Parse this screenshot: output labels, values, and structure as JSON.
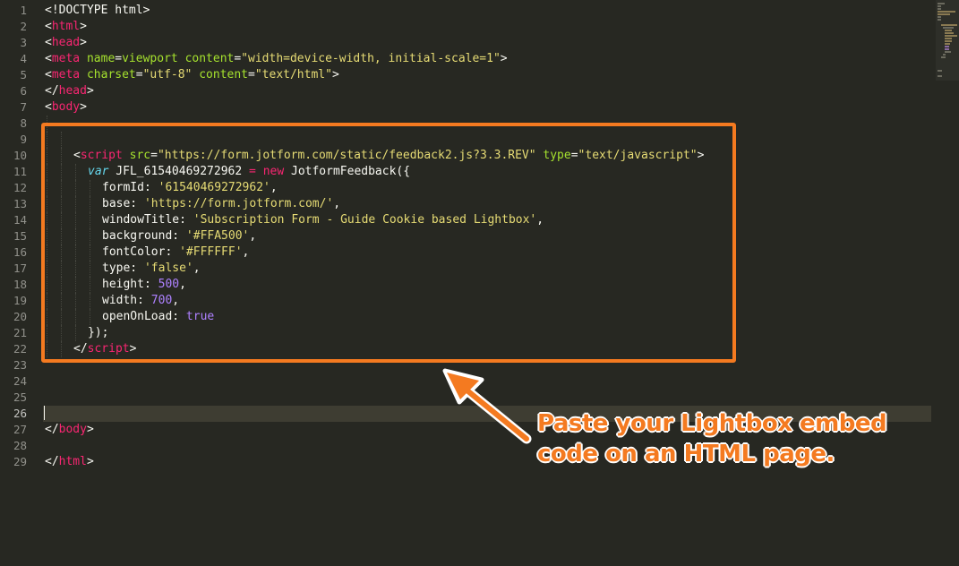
{
  "editor": {
    "theme_colors": {
      "background": "#272822",
      "tag": "#f92672",
      "attribute": "#a6e22e",
      "string": "#e6db74",
      "number": "#ae81ff",
      "keyword_italic": "#66d9ef",
      "highlight_box": "#f47a20"
    },
    "active_line": 26,
    "line_numbers": [
      "1",
      "2",
      "3",
      "4",
      "5",
      "6",
      "7",
      "8",
      "9",
      "10",
      "11",
      "12",
      "13",
      "14",
      "15",
      "16",
      "17",
      "18",
      "19",
      "20",
      "21",
      "22",
      "23",
      "24",
      "25",
      "26",
      "27",
      "28",
      "29"
    ],
    "lines": {
      "l1": {
        "a": "<!DOCTYPE html>"
      },
      "l2": {
        "a": "<",
        "b": "html",
        "c": ">"
      },
      "l3": {
        "a": "<",
        "b": "head",
        "c": ">"
      },
      "l4": {
        "a": "<",
        "b": "meta",
        "c": " ",
        "d": "name",
        "e": "=",
        "f": "viewport",
        "g": " ",
        "h": "content",
        "i": "=",
        "j": "\"width=device-width, initial-scale=1\"",
        "k": ">"
      },
      "l5": {
        "a": "<",
        "b": "meta",
        "c": " ",
        "d": "charset",
        "e": "=",
        "f": "\"utf-8\"",
        "g": " ",
        "h": "content",
        "i": "=",
        "j": "\"text/html\"",
        "k": ">"
      },
      "l6": {
        "a": "</",
        "b": "head",
        "c": ">"
      },
      "l7": {
        "a": "<",
        "b": "body",
        "c": ">"
      },
      "l10": {
        "a": "<",
        "b": "script",
        "c": " ",
        "d": "src",
        "e": "=",
        "f": "\"https://form.jotform.com/static/feedback2.js?3.3.REV\"",
        "g": " ",
        "h": "type",
        "i": "=",
        "j": "\"text/javascript\"",
        "k": ">"
      },
      "l11": {
        "a": "var",
        "b": " JFL_61540469272962 ",
        "c": "=",
        "d": " ",
        "e": "new",
        "f": " JotformFeedback({"
      },
      "l12": {
        "a": "formId: ",
        "b": "'61540469272962'",
        "c": ","
      },
      "l13": {
        "a": "base: ",
        "b": "'https://form.jotform.com/'",
        "c": ","
      },
      "l14": {
        "a": "windowTitle: ",
        "b": "'Subscription Form - Guide Cookie based Lightbox'",
        "c": ","
      },
      "l15": {
        "a": "background: ",
        "b": "'#FFA500'",
        "c": ","
      },
      "l16": {
        "a": "fontColor: ",
        "b": "'#FFFFFF'",
        "c": ","
      },
      "l17": {
        "a": "type: ",
        "b": "'false'",
        "c": ","
      },
      "l18": {
        "a": "height: ",
        "b": "500",
        "c": ","
      },
      "l19": {
        "a": "width: ",
        "b": "700",
        "c": ","
      },
      "l20": {
        "a": "openOnLoad: ",
        "b": "true"
      },
      "l21": {
        "a": "});"
      },
      "l22": {
        "a": "</",
        "b": "script",
        "c": ">"
      },
      "l27": {
        "a": "</",
        "b": "body",
        "c": ">"
      },
      "l29": {
        "a": "</",
        "b": "html",
        "c": ">"
      }
    }
  },
  "callout": {
    "line1": "Paste your Lightbox embed",
    "line2": "code on an HTML page."
  }
}
